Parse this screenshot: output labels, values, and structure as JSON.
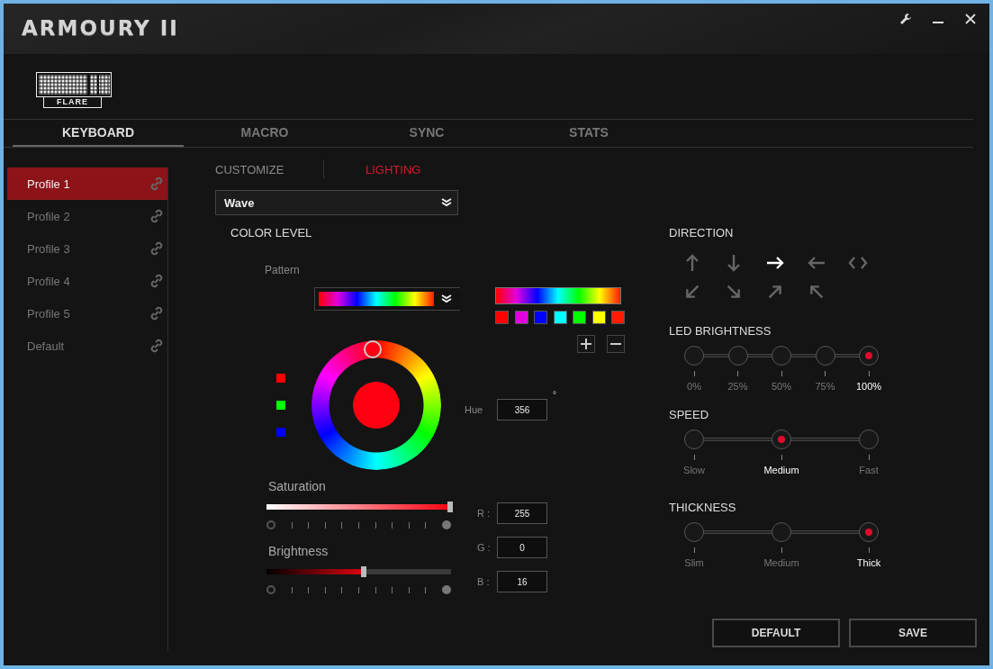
{
  "window": {
    "title": "ARMOURY II"
  },
  "device": {
    "name": "FLARE"
  },
  "tabs": [
    {
      "label": "KEYBOARD",
      "selected": true
    },
    {
      "label": "MACRO",
      "selected": false
    },
    {
      "label": "SYNC",
      "selected": false
    },
    {
      "label": "STATS",
      "selected": false
    }
  ],
  "profiles": [
    {
      "label": "Profile 1",
      "selected": true
    },
    {
      "label": "Profile 2",
      "selected": false
    },
    {
      "label": "Profile 3",
      "selected": false
    },
    {
      "label": "Profile 4",
      "selected": false
    },
    {
      "label": "Profile 5",
      "selected": false
    },
    {
      "label": "Default",
      "selected": false
    }
  ],
  "subtabs": [
    {
      "label": "CUSTOMIZE",
      "selected": false
    },
    {
      "label": "LIGHTING",
      "selected": true
    }
  ],
  "effect_dropdown": {
    "value": "Wave"
  },
  "color_level": {
    "title": "COLOR LEVEL",
    "pattern_label": "Pattern",
    "stops": [
      {
        "color": "#ff0000"
      },
      {
        "color": "#e000e0"
      },
      {
        "color": "#0000ff"
      },
      {
        "color": "#00ffff"
      },
      {
        "color": "#00ff00"
      },
      {
        "color": "#ffff00"
      },
      {
        "color": "#ff1a00"
      }
    ],
    "hue": {
      "label": "Hue",
      "value": "356",
      "unit": "°"
    },
    "saturation": {
      "label": "Saturation",
      "level": 1
    },
    "brightness": {
      "label": "Brightness",
      "level": 0.53
    },
    "rgb": [
      {
        "label": "R :",
        "value": "255"
      },
      {
        "label": "G :",
        "value": "0"
      },
      {
        "label": "B :",
        "value": "16"
      }
    ]
  },
  "direction": {
    "title": "DIRECTION",
    "options": [
      {
        "kind": "up",
        "selected": false
      },
      {
        "kind": "down",
        "selected": false
      },
      {
        "kind": "right",
        "selected": true
      },
      {
        "kind": "left",
        "selected": false
      },
      {
        "kind": "left-right",
        "selected": false
      },
      {
        "kind": "down-left",
        "selected": false
      },
      {
        "kind": "down-right",
        "selected": false
      },
      {
        "kind": "up-right",
        "selected": false
      },
      {
        "kind": "up-left",
        "selected": false
      }
    ]
  },
  "led_brightness": {
    "title": "LED BRIGHTNESS",
    "steps": [
      {
        "label": "0%",
        "selected": false
      },
      {
        "label": "25%",
        "selected": false
      },
      {
        "label": "50%",
        "selected": false
      },
      {
        "label": "75%",
        "selected": false
      },
      {
        "label": "100%",
        "selected": true
      }
    ]
  },
  "speed": {
    "title": "SPEED",
    "steps": [
      {
        "label": "Slow",
        "selected": false
      },
      {
        "label": "Medium",
        "selected": true
      },
      {
        "label": "Fast",
        "selected": false
      }
    ]
  },
  "thickness": {
    "title": "THICKNESS",
    "steps": [
      {
        "label": "Slim",
        "selected": false
      },
      {
        "label": "Medium",
        "selected": false
      },
      {
        "label": "Thick",
        "selected": true
      }
    ]
  },
  "buttons": [
    {
      "label": "DEFAULT"
    },
    {
      "label": "SAVE"
    }
  ]
}
